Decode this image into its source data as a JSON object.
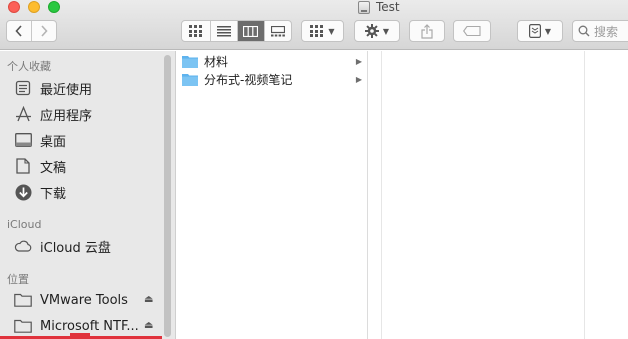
{
  "window": {
    "title": "Test"
  },
  "toolbar": {
    "search_placeholder": "搜索",
    "accent_active": "#6c6c6c"
  },
  "sidebar": {
    "favorites_header": "个人收藏",
    "favorites": [
      {
        "label": "最近使用",
        "icon": "recents-icon"
      },
      {
        "label": "应用程序",
        "icon": "applications-icon"
      },
      {
        "label": "桌面",
        "icon": "desktop-icon"
      },
      {
        "label": "文稿",
        "icon": "documents-icon"
      },
      {
        "label": "下载",
        "icon": "downloads-icon"
      }
    ],
    "icloud_header": "iCloud",
    "icloud": [
      {
        "label": "iCloud 云盘",
        "icon": "cloud-icon"
      }
    ],
    "locations_header": "位置",
    "locations": [
      {
        "label": "VMware Tools",
        "icon": "drive-folder-icon"
      },
      {
        "label": "Microsoft NTF...",
        "icon": "drive-folder-icon"
      }
    ]
  },
  "browser": {
    "column1": [
      {
        "name": "材料"
      },
      {
        "name": "分布式-视频笔记"
      }
    ]
  }
}
